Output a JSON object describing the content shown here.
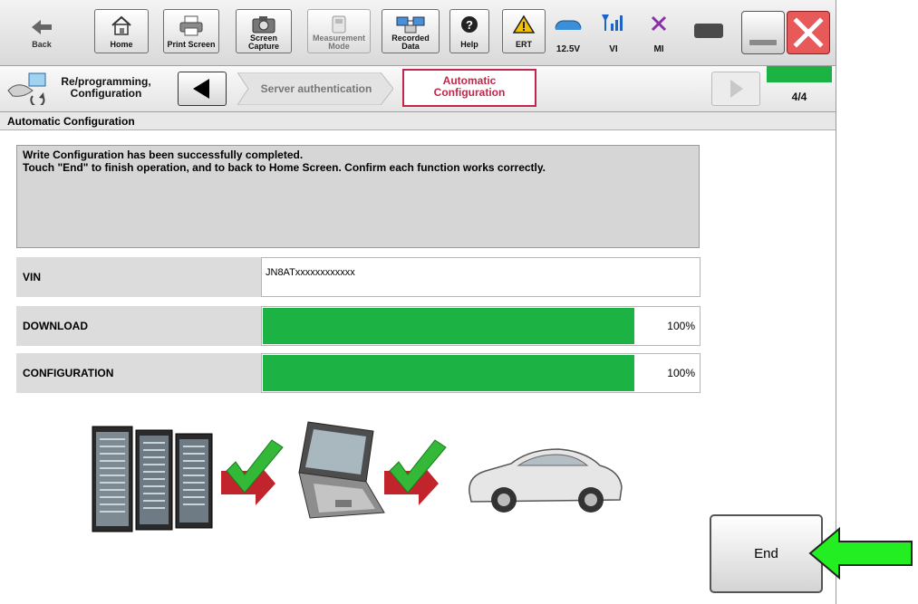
{
  "toolbar": {
    "back_label": "Back",
    "home_label": "Home",
    "print_label": "Print Screen",
    "screen_capture_label": "Screen\nCapture",
    "measurement_label": "Measurement\nMode",
    "recorded_label": "Recorded\nData",
    "help_label": "Help",
    "ert_label": "ERT",
    "voltage_label": "12.5V",
    "vi_label": "VI",
    "mi_label": "MI"
  },
  "nav": {
    "crumb_label": "Re/programming,\nConfiguration",
    "step_server": "Server authentication",
    "step_auto": "Automatic\nConfiguration",
    "page_indicator": "4/4",
    "step_progress": 1.0
  },
  "page": {
    "title": "Automatic Configuration",
    "message": "Write Configuration has been successfully completed.\nTouch \"End\" to finish operation, and to back to Home Screen. Confirm each function works correctly."
  },
  "rows": {
    "vin_label": "VIN",
    "vin_value": "JN8ATxxxxxxxxxxxx",
    "download_label": "DOWNLOAD",
    "download_percent": "100%",
    "download_progress": 1.0,
    "config_label": "CONFIGURATION",
    "config_percent": "100%",
    "config_progress": 1.0
  },
  "end_label": "End",
  "colors": {
    "progress": "#1db344",
    "active_step_border": "#c4264b",
    "active_step_text": "#c4264b",
    "callout_arrow": "#22ee22",
    "close_button": "#e8595a"
  }
}
